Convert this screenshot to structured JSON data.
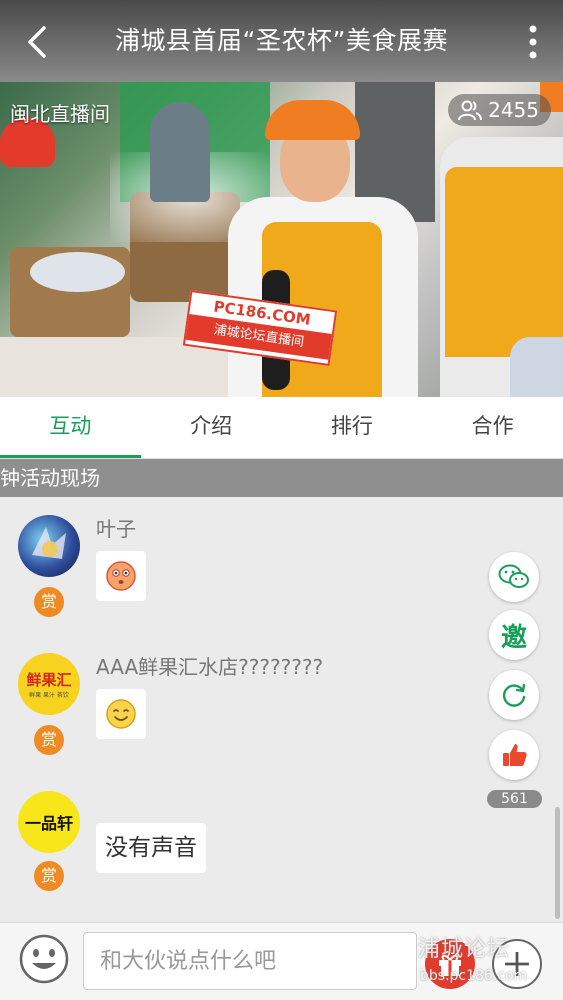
{
  "header": {
    "title": "浦城县首届“圣农杯”美食展赛"
  },
  "video": {
    "room_name": "闽北直播间",
    "viewer_count": "2455",
    "mic_label": "PC186.COM",
    "mic_sub": "浦城论坛直播间"
  },
  "tabs": [
    {
      "label": "互动",
      "active": true
    },
    {
      "label": "介绍",
      "active": false
    },
    {
      "label": "排行",
      "active": false
    },
    {
      "label": "合作",
      "active": false
    }
  ],
  "banner": {
    "text": "钟活动现场"
  },
  "messages": [
    {
      "user": "叶子",
      "type": "emoji",
      "emoji": "flushed-face",
      "reward": "赏"
    },
    {
      "user": "AAA鲜果汇水店????????",
      "type": "emoji",
      "emoji": "smiling-face",
      "reward": "赏",
      "avatar_text": "鲜果汇",
      "avatar_sub": "鲜果 果汁 茶饮"
    },
    {
      "user": "",
      "type": "text",
      "text": "没有声音",
      "reward": "赏",
      "avatar_text": "一品轩"
    }
  ],
  "actions": {
    "invite_label": "邀",
    "like_count": "561"
  },
  "input": {
    "placeholder": "和大伙说点什么吧"
  },
  "watermark": {
    "line1": "浦城论坛",
    "line2": "bbs.pc186.com"
  },
  "colors": {
    "accent": "#1a9f5b",
    "reward": "#f08a22",
    "like": "#e8492f",
    "gift": "#e23b2c"
  }
}
